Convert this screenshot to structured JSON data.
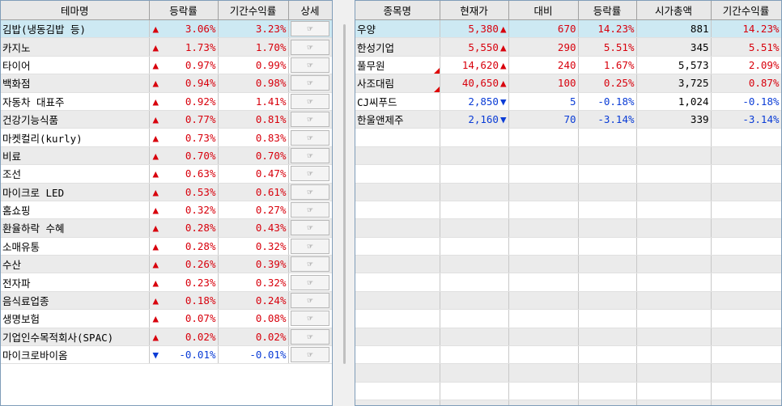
{
  "left": {
    "headers": [
      "테마명",
      "등락률",
      "기간수익률",
      "상세"
    ],
    "detail_icon": "memo-icon",
    "rows": [
      {
        "name": "김밥(냉동김밥 등)",
        "dir": "up",
        "rate": "3.06%",
        "period": "3.23%",
        "sel": true
      },
      {
        "name": "카지노",
        "dir": "up",
        "rate": "1.73%",
        "period": "1.70%"
      },
      {
        "name": "타이어",
        "dir": "up",
        "rate": "0.97%",
        "period": "0.99%"
      },
      {
        "name": "백화점",
        "dir": "up",
        "rate": "0.94%",
        "period": "0.98%"
      },
      {
        "name": "자동차 대표주",
        "dir": "up",
        "rate": "0.92%",
        "period": "1.41%"
      },
      {
        "name": "건강기능식품",
        "dir": "up",
        "rate": "0.77%",
        "period": "0.81%"
      },
      {
        "name": "마켓컬리(kurly)",
        "dir": "up",
        "rate": "0.73%",
        "period": "0.83%"
      },
      {
        "name": "비료",
        "dir": "up",
        "rate": "0.70%",
        "period": "0.70%"
      },
      {
        "name": "조선",
        "dir": "up",
        "rate": "0.63%",
        "period": "0.47%"
      },
      {
        "name": "마이크로 LED",
        "dir": "up",
        "rate": "0.53%",
        "period": "0.61%"
      },
      {
        "name": "홈쇼핑",
        "dir": "up",
        "rate": "0.32%",
        "period": "0.27%"
      },
      {
        "name": "환율하락 수혜",
        "dir": "up",
        "rate": "0.28%",
        "period": "0.43%"
      },
      {
        "name": "소매유통",
        "dir": "up",
        "rate": "0.28%",
        "period": "0.32%"
      },
      {
        "name": "수산",
        "dir": "up",
        "rate": "0.26%",
        "period": "0.39%"
      },
      {
        "name": "전자파",
        "dir": "up",
        "rate": "0.23%",
        "period": "0.32%"
      },
      {
        "name": "음식료업종",
        "dir": "up",
        "rate": "0.18%",
        "period": "0.24%"
      },
      {
        "name": "생명보험",
        "dir": "up",
        "rate": "0.07%",
        "period": "0.08%"
      },
      {
        "name": "기업인수목적회사(SPAC)",
        "dir": "up",
        "rate": "0.02%",
        "period": "0.02%"
      },
      {
        "name": "마이크로바이옴",
        "dir": "dn",
        "rate": "-0.01%",
        "period": "-0.01%"
      }
    ]
  },
  "right": {
    "headers": [
      "종목명",
      "현재가",
      "대비",
      "등락률",
      "시가총액",
      "기간수익률"
    ],
    "rows": [
      {
        "name": "우양",
        "price": "5,380",
        "dir": "up",
        "change": "670",
        "rate": "14.23%",
        "cap": "881",
        "period": "14.23%",
        "sel": true
      },
      {
        "name": "한성기업",
        "price": "5,550",
        "dir": "up",
        "change": "290",
        "rate": "5.51%",
        "cap": "345",
        "period": "5.51%"
      },
      {
        "name": "풀무원",
        "price": "14,620",
        "dir": "up",
        "change": "240",
        "rate": "1.67%",
        "cap": "5,573",
        "period": "2.09%",
        "flag": true
      },
      {
        "name": "사조대림",
        "price": "40,650",
        "dir": "up",
        "change": "100",
        "rate": "0.25%",
        "cap": "3,725",
        "period": "0.87%",
        "flag": true
      },
      {
        "name": "CJ씨푸드",
        "price": "2,850",
        "dir": "dn",
        "change": "5",
        "rate": "-0.18%",
        "cap": "1,024",
        "period": "-0.18%"
      },
      {
        "name": "한울앤제주",
        "price": "2,160",
        "dir": "dn",
        "change": "70",
        "rate": "-3.14%",
        "cap": "339",
        "period": "-3.14%"
      }
    ],
    "empty_rows": 16
  },
  "colors": {
    "up": "#d8000c",
    "down": "#0a3cd6",
    "selected": "#cde9f3",
    "header": "#e8e8e8"
  }
}
